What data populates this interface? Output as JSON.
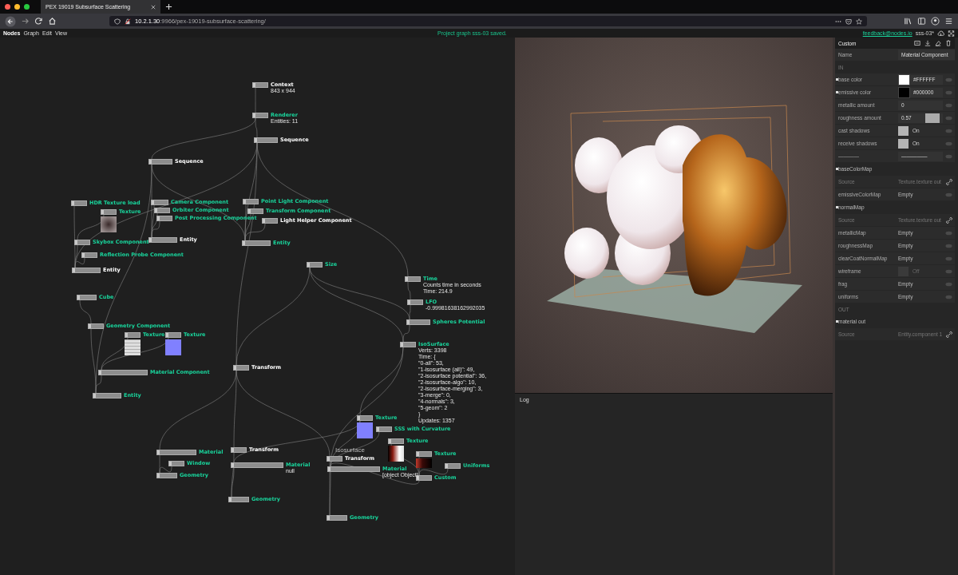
{
  "browser": {
    "tab_title": "PEX 19019 Subsurface Scattering",
    "url": "**10.2.1.30**:9966/pex-19019-subsurface-scattering/"
  },
  "menubar": {
    "items": [
      "Nodes",
      "Graph",
      "Edit",
      "View"
    ],
    "status": "Project graph sss-03 saved.",
    "feedback": "feedback@nodes.io",
    "project": "sss-03*"
  },
  "graph": {
    "group_labels": [
      "Isosurface"
    ],
    "nodes": [
      {
        "title": "Context",
        "color": "#ffffff",
        "lines": [
          "843 x 944"
        ]
      },
      {
        "title": "Renderer",
        "color": "#19d39b",
        "lines": [
          "Entities: 11"
        ]
      },
      {
        "title": "Sequence",
        "color": "#ffffff"
      },
      {
        "title": "Sequence",
        "color": "#ffffff"
      },
      {
        "title": "HDR Texture load",
        "color": "#19d39b"
      },
      {
        "title": "Texture",
        "color": "#19d39b",
        "thumbnail": {
          "kind": "radial"
        }
      },
      {
        "title": "Skybox Component",
        "color": "#19d39b"
      },
      {
        "title": "Reflection Probe Component",
        "color": "#19d39b"
      },
      {
        "title": "Entity",
        "color": "#ffffff"
      },
      {
        "title": "Camera Component",
        "color": "#19d39b"
      },
      {
        "title": "Orbiter Component",
        "color": "#19d39b"
      },
      {
        "title": "Post Processing Component",
        "color": "#19d39b"
      },
      {
        "title": "Entity",
        "color": "#ffffff"
      },
      {
        "title": "Point Light Component",
        "color": "#19d39b"
      },
      {
        "title": "Transform Component",
        "color": "#19d39b"
      },
      {
        "title": "Light Helper Component",
        "color": "#ffffff"
      },
      {
        "title": "Entity",
        "color": "#19d39b"
      },
      {
        "title": "Size",
        "color": "#19d39b"
      },
      {
        "title": "Time",
        "color": "#19d39b",
        "lines": [
          "Counts time in seconds",
          "Time: 214.9"
        ]
      },
      {
        "title": "LFO",
        "color": "#19d39b",
        "lines": [
          "-0.99981638162992035"
        ]
      },
      {
        "title": "Spheres Potential",
        "color": "#19d39b"
      },
      {
        "title": "IsoSurface",
        "color": "#19d39b",
        "lines": [
          "Verts: 3398",
          "Time: {",
          "\"0-all\": 53,",
          "\"1-isosurface (all)\": 49,",
          "\"2-isosurface potential\": 36,",
          "\"2-isosurface-algo\": 10,",
          "\"2-isosurface-merging\": 3,",
          "\"3-merge\": 0,",
          "\"4-normals\": 3,",
          "\"5-geom\": 2",
          "}",
          "Updates: 1357"
        ]
      },
      {
        "title": "Cube",
        "color": "#19d39b"
      },
      {
        "title": "Geometry Component",
        "color": "#19d39b"
      },
      {
        "title": "Texture",
        "color": "#19d39b",
        "thumbnail": {
          "kind": "tiles"
        }
      },
      {
        "title": "Texture",
        "color": "#19d39b",
        "thumbnail": {
          "kind": "normal"
        }
      },
      {
        "title": "Material Component",
        "color": "#19d39b"
      },
      {
        "title": "Entity",
        "color": "#19d39b"
      },
      {
        "title": "Transform",
        "color": "#ffffff"
      },
      {
        "title": "Texture",
        "color": "#19d39b",
        "thumbnail": {
          "kind": "normal"
        }
      },
      {
        "title": "SSS with Curvature",
        "color": "#19d39b"
      },
      {
        "title": "Texture",
        "color": "#19d39b",
        "thumbnail": {
          "kind": "gradient"
        }
      },
      {
        "title": "Texture",
        "color": "#19d39b",
        "thumbnail": {
          "kind": "red"
        }
      },
      {
        "title": "Uniforms",
        "color": "#19d39b"
      },
      {
        "title": "Custom",
        "color": "#19d39b"
      },
      {
        "title": "Material",
        "color": "#19d39b"
      },
      {
        "title": "Window",
        "color": "#19d39b"
      },
      {
        "title": "Geometry",
        "color": "#19d39b"
      },
      {
        "title": "Transform",
        "color": "#ffffff"
      },
      {
        "title": "Material",
        "color": "#19d39b",
        "lines": [
          "null"
        ]
      },
      {
        "title": "Geometry",
        "color": "#19d39b"
      },
      {
        "title": "Transform",
        "color": "#ffffff"
      },
      {
        "title": "Material",
        "color": "#19d39b",
        "lines": [
          "[object Object]"
        ]
      },
      {
        "title": "Geometry",
        "color": "#19d39b"
      }
    ]
  },
  "log": {
    "title": "Log"
  },
  "inspector": {
    "title": "Custom",
    "name_label": "Name",
    "name_value": "Material Component",
    "rows": [
      {
        "kind": "section",
        "label": "IN",
        "dot": false
      },
      {
        "kind": "color",
        "label": "base color",
        "value": "#FFFFFF",
        "dot": true
      },
      {
        "kind": "color",
        "label": "emissive color",
        "value": "#000000",
        "dot": true
      },
      {
        "kind": "number",
        "label": "metallic amount",
        "value": "0",
        "dot": false
      },
      {
        "kind": "slider",
        "label": "roughness amount",
        "value": "0.57",
        "level": 0.57,
        "dot": false
      },
      {
        "kind": "toggle",
        "label": "cast shadows",
        "value": "On",
        "on": true,
        "dot": false
      },
      {
        "kind": "toggle",
        "label": "receive shadows",
        "value": "On",
        "on": true,
        "dot": false
      },
      {
        "kind": "number",
        "label": "————",
        "value": "—————",
        "dot": false
      },
      {
        "kind": "group",
        "label": "baseColorMap",
        "dot": true
      },
      {
        "kind": "source",
        "label": "Source",
        "value": "Texture.texture out",
        "dot": false
      },
      {
        "kind": "empty",
        "label": "emissiveColorMap",
        "value": "Empty",
        "dot": false
      },
      {
        "kind": "group",
        "label": "normalMap",
        "dot": true
      },
      {
        "kind": "source",
        "label": "Source",
        "value": "Texture.texture out",
        "dot": false
      },
      {
        "kind": "empty",
        "label": "metallicMap",
        "value": "Empty",
        "dot": false
      },
      {
        "kind": "empty",
        "label": "roughnessMap",
        "value": "Empty",
        "dot": false
      },
      {
        "kind": "empty",
        "label": "clearCoatNormalMap",
        "value": "Empty",
        "dot": false
      },
      {
        "kind": "toggle",
        "label": "wireframe",
        "value": "Off",
        "on": false,
        "dot": false
      },
      {
        "kind": "empty",
        "label": "frag",
        "value": "Empty",
        "dot": false
      },
      {
        "kind": "empty",
        "label": "uniforms",
        "value": "Empty",
        "dot": false
      },
      {
        "kind": "section",
        "label": "OUT",
        "dot": false
      },
      {
        "kind": "group",
        "label": "material out",
        "dot": true
      },
      {
        "kind": "source",
        "label": "Source",
        "value": "Entity.component 1",
        "dot": false
      }
    ]
  }
}
